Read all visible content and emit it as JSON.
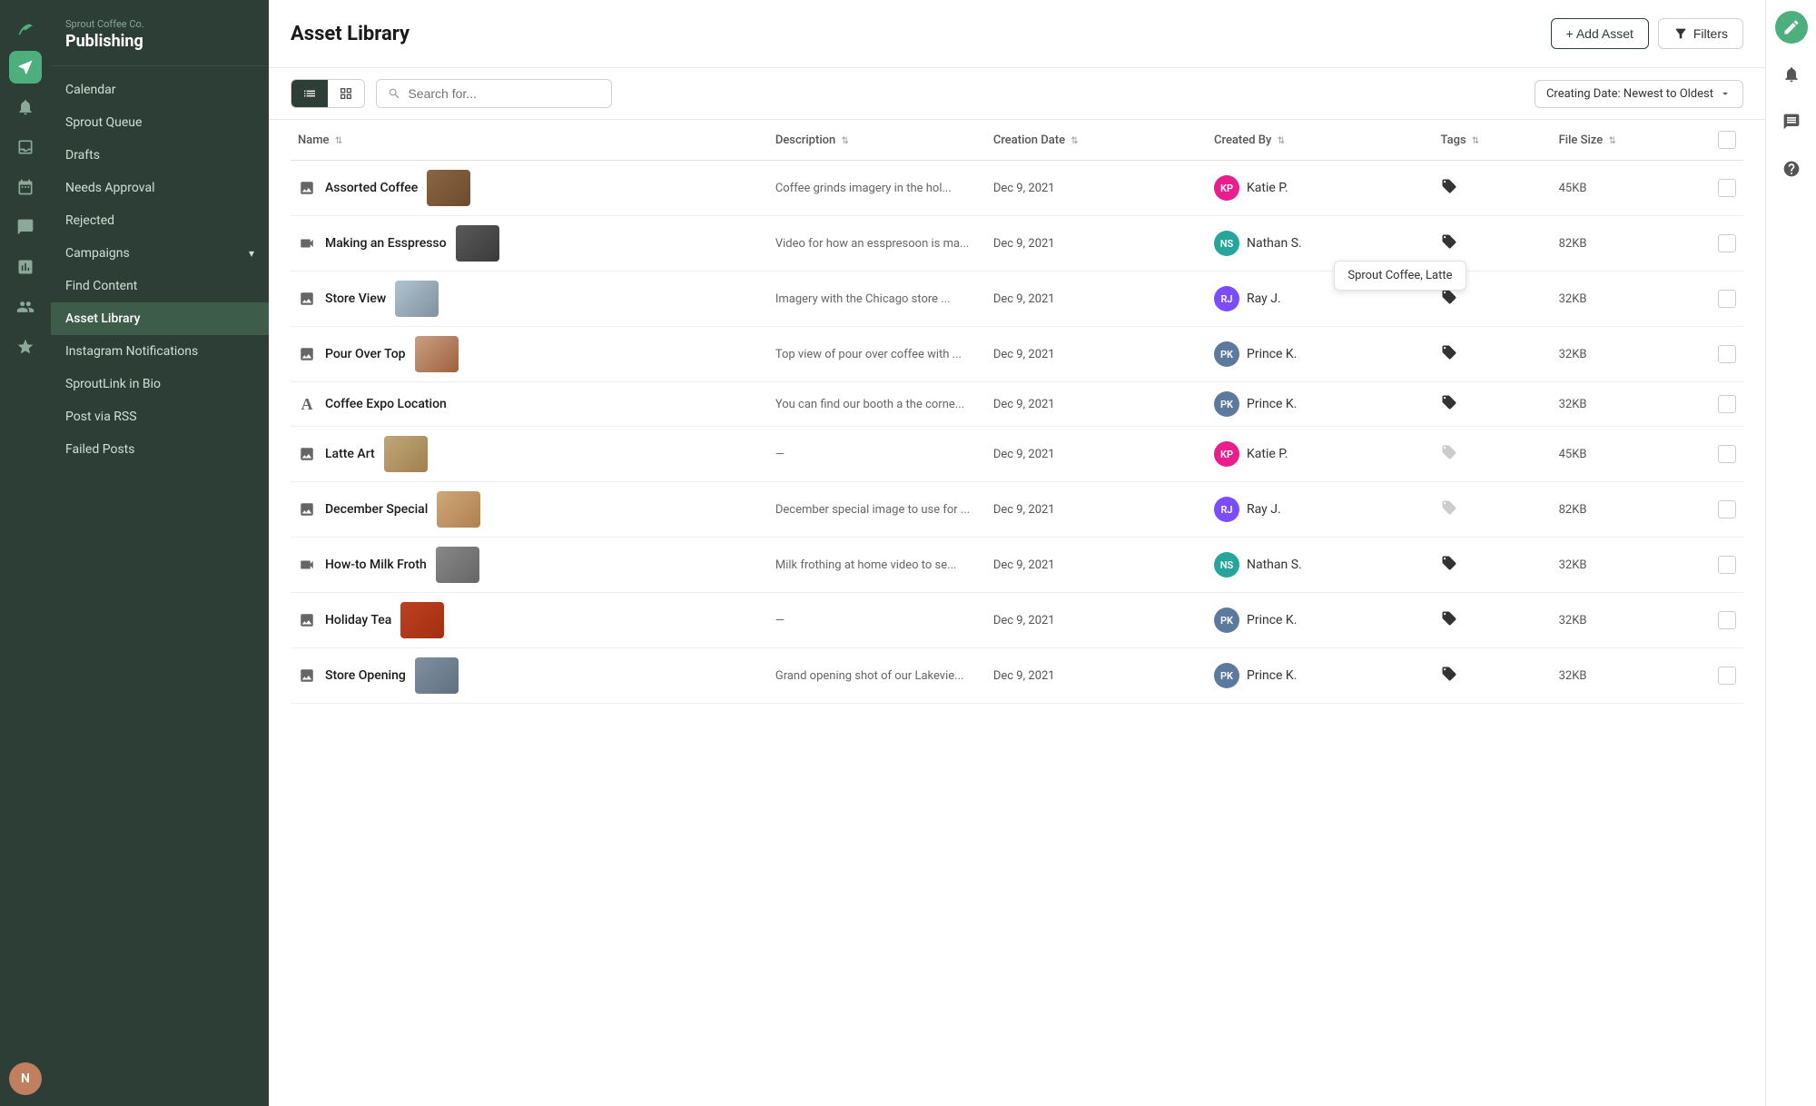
{
  "brand": {
    "company": "Sprout Coffee Co.",
    "section": "Publishing"
  },
  "sidebar": {
    "items": [
      {
        "id": "calendar",
        "label": "Calendar",
        "active": false
      },
      {
        "id": "sprout-queue",
        "label": "Sprout Queue",
        "active": false
      },
      {
        "id": "drafts",
        "label": "Drafts",
        "active": false
      },
      {
        "id": "needs-approval",
        "label": "Needs Approval",
        "active": false
      },
      {
        "id": "rejected",
        "label": "Rejected",
        "active": false
      },
      {
        "id": "campaigns",
        "label": "Campaigns",
        "active": false,
        "hasArrow": true
      },
      {
        "id": "find-content",
        "label": "Find Content",
        "active": false
      },
      {
        "id": "asset-library",
        "label": "Asset Library",
        "active": true
      },
      {
        "id": "instagram-notifications",
        "label": "Instagram Notifications",
        "active": false
      },
      {
        "id": "sproutlink-in-bio",
        "label": "SproutLink in Bio",
        "active": false
      },
      {
        "id": "post-via-rss",
        "label": "Post via RSS",
        "active": false
      },
      {
        "id": "failed-posts",
        "label": "Failed Posts",
        "active": false
      }
    ]
  },
  "page": {
    "title": "Asset Library"
  },
  "buttons": {
    "add_asset": "+ Add Asset",
    "filters": "Filters"
  },
  "toolbar": {
    "search_placeholder": "Search for...",
    "sort_label": "Creating Date: Newest to Oldest"
  },
  "table": {
    "columns": [
      {
        "id": "name",
        "label": "Name"
      },
      {
        "id": "description",
        "label": "Description"
      },
      {
        "id": "creation_date",
        "label": "Creation Date"
      },
      {
        "id": "created_by",
        "label": "Created By"
      },
      {
        "id": "tags",
        "label": "Tags"
      },
      {
        "id": "file_size",
        "label": "File Size"
      }
    ],
    "rows": [
      {
        "id": 1,
        "type": "image",
        "name": "Assorted Coffee",
        "description": "Coffee grinds imagery in the hol...",
        "date": "Dec 9, 2021",
        "creator": "Katie P.",
        "creator_color": "#e91e8c",
        "creator_initials": "KP",
        "file_size": "45KB",
        "has_tag": true,
        "tag_filled": true,
        "thumb_class": "thumb-coffee"
      },
      {
        "id": 2,
        "type": "video",
        "name": "Making an Esspresso",
        "description": "Video for how an esspresoon is ma...",
        "date": "Dec 9, 2021",
        "creator": "Nathan S.",
        "creator_color": "#26a69a",
        "creator_initials": "NS",
        "file_size": "82KB",
        "has_tag": true,
        "tag_filled": true,
        "thumb_class": "thumb-espresso",
        "tooltip": "Sprout Coffee, Latte"
      },
      {
        "id": 3,
        "type": "image",
        "name": "Store View",
        "description": "Imagery with the Chicago store ...",
        "date": "Dec 9, 2021",
        "creator": "Ray J.",
        "creator_color": "#7c4dff",
        "creator_initials": "RJ",
        "file_size": "32KB",
        "has_tag": true,
        "tag_filled": true,
        "thumb_class": "thumb-store"
      },
      {
        "id": 4,
        "type": "image",
        "name": "Pour Over Top",
        "description": "Top view of pour over coffee with ...",
        "date": "Dec 9, 2021",
        "creator": "Prince K.",
        "creator_color": "#5c7a9e",
        "creator_initials": "PK",
        "file_size": "32KB",
        "has_tag": true,
        "tag_filled": true,
        "thumb_class": "thumb-pour"
      },
      {
        "id": 5,
        "type": "text",
        "name": "Coffee Expo Location",
        "description": "You can find our booth a the corne...",
        "date": "Dec 9, 2021",
        "creator": "Prince K.",
        "creator_color": "#5c7a9e",
        "creator_initials": "PK",
        "file_size": "32KB",
        "has_tag": true,
        "tag_filled": true,
        "thumb_class": ""
      },
      {
        "id": 6,
        "type": "image",
        "name": "Latte Art",
        "description": "—",
        "date": "Dec 9, 2021",
        "creator": "Katie P.",
        "creator_color": "#e91e8c",
        "creator_initials": "KP",
        "file_size": "45KB",
        "has_tag": true,
        "tag_filled": false,
        "thumb_class": "thumb-latte"
      },
      {
        "id": 7,
        "type": "image",
        "name": "December Special",
        "description": "December special image to use for ...",
        "date": "Dec 9, 2021",
        "creator": "Ray J.",
        "creator_color": "#7c4dff",
        "creator_initials": "RJ",
        "file_size": "82KB",
        "has_tag": true,
        "tag_filled": false,
        "thumb_class": "thumb-december"
      },
      {
        "id": 8,
        "type": "video",
        "name": "How-to Milk Froth",
        "description": "Milk frothing at home video to se...",
        "date": "Dec 9, 2021",
        "creator": "Nathan S.",
        "creator_color": "#26a69a",
        "creator_initials": "NS",
        "file_size": "32KB",
        "has_tag": true,
        "tag_filled": true,
        "thumb_class": "thumb-froth"
      },
      {
        "id": 9,
        "type": "image",
        "name": "Holiday Tea",
        "description": "—",
        "date": "Dec 9, 2021",
        "creator": "Prince K.",
        "creator_color": "#5c7a9e",
        "creator_initials": "PK",
        "file_size": "32KB",
        "has_tag": true,
        "tag_filled": true,
        "thumb_class": "thumb-tea"
      },
      {
        "id": 10,
        "type": "image",
        "name": "Store Opening",
        "description": "Grand opening shot of our Lakevie...",
        "date": "Dec 9, 2021",
        "creator": "Prince K.",
        "creator_color": "#5c7a9e",
        "creator_initials": "PK",
        "file_size": "32KB",
        "has_tag": true,
        "tag_filled": true,
        "thumb_class": "thumb-opening"
      }
    ]
  }
}
